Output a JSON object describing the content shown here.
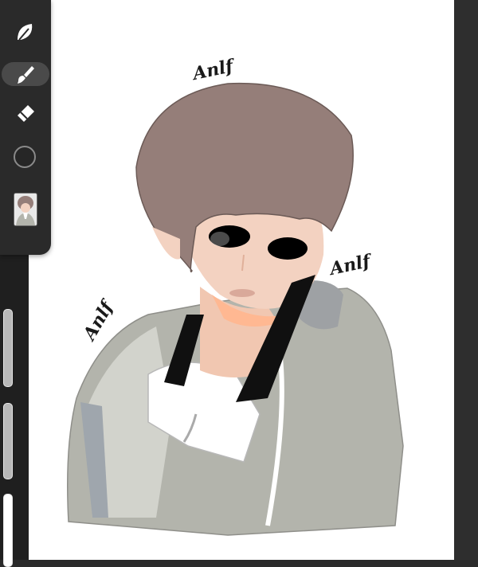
{
  "app": {
    "toolbar": {
      "tools": [
        {
          "name": "adjustments",
          "icon": "leaf-icon",
          "active": false
        },
        {
          "name": "brush",
          "icon": "brush-icon",
          "active": true
        },
        {
          "name": "eraser",
          "icon": "eraser-icon",
          "active": false
        }
      ],
      "current_color": "#262626"
    },
    "sliders": {
      "brush_size": 0.55,
      "opacity": 0.5
    },
    "canvas": {
      "background": "#ffffff",
      "signature_text": "Anlf"
    },
    "colors": {
      "hair": "#957e79",
      "skin": "#f3d2c1",
      "jacket": "#b3b4ac",
      "headphones": "#101010",
      "ui_dark": "#2a2a2a"
    }
  }
}
